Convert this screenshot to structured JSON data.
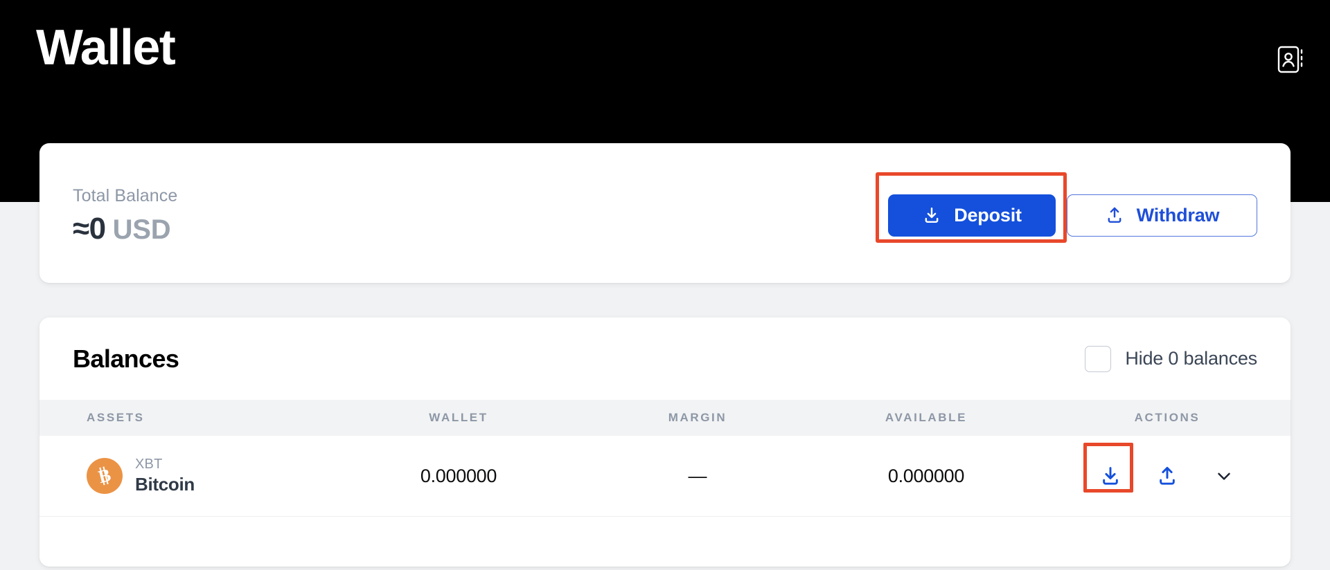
{
  "header": {
    "title": "Wallet",
    "address_book_icon": "address-book-icon"
  },
  "balance_card": {
    "label": "Total Balance",
    "amount": "≈0",
    "currency": "USD",
    "deposit_label": "Deposit",
    "withdraw_label": "Withdraw",
    "deposit_icon": "download-tray-icon",
    "withdraw_icon": "upload-tray-icon"
  },
  "balances": {
    "title": "Balances",
    "hide_zero_label": "Hide 0 balances",
    "hide_zero_checked": false,
    "columns": [
      "ASSETS",
      "WALLET",
      "MARGIN",
      "AVAILABLE",
      "ACTIONS"
    ],
    "rows": [
      {
        "symbol": "XBT",
        "name": "Bitcoin",
        "icon": "bitcoin-icon",
        "wallet": "0.000000",
        "margin": "—",
        "available": "0.000000",
        "actions": [
          "row-deposit-icon",
          "row-withdraw-icon",
          "row-expand-chevron-icon"
        ]
      }
    ]
  },
  "colors": {
    "hero_background": "#000000",
    "page_background": "#f1f2f3",
    "primary_blue": "#1450dc",
    "outline_blue": "#1f4fd8",
    "highlight_orange": "#e8482a",
    "bitcoin_orange": "#eb9345",
    "muted_text": "#8d97a6"
  },
  "annotations": {
    "deposit_button_highlight": true,
    "row_deposit_icon_highlight": true
  }
}
